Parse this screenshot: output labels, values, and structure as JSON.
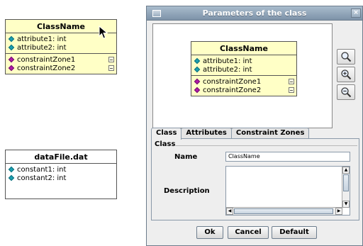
{
  "canvas": {
    "class_box": {
      "name": "ClassName",
      "attributes": [
        "attribute1: int",
        "attribute2: int"
      ],
      "constraint_zones": [
        "constraintZone1",
        "constraintZone2"
      ]
    },
    "data_file_box": {
      "name": "dataFile.dat",
      "constants": [
        "constant1: int",
        "constant2: int"
      ]
    }
  },
  "dialog": {
    "title": "Parameters of the class",
    "close_glyph": "×",
    "preview": {
      "name": "ClassName",
      "attributes": [
        "attribute1: int",
        "attribute2: int"
      ],
      "constraint_zones": [
        "constraintZone1",
        "constraintZone2"
      ]
    },
    "zoom_buttons": [
      "zoom-fit-icon",
      "zoom-in-icon",
      "zoom-out-icon"
    ],
    "tabs": [
      "Class",
      "Attributes",
      "Constraint Zones"
    ],
    "active_tab": "Class",
    "class_group_label": "Class",
    "name_label": "Name",
    "name_value": "ClassName",
    "description_label": "Description",
    "description_value": "",
    "buttons": {
      "ok": "Ok",
      "cancel": "Cancel",
      "default": "Default"
    }
  },
  "colors": {
    "class_fill": "#ffffc6",
    "attribute_bullet": "#1a9fb0",
    "constraint_bullet": "#b01aa8",
    "titlebar": "#7d92a8"
  }
}
